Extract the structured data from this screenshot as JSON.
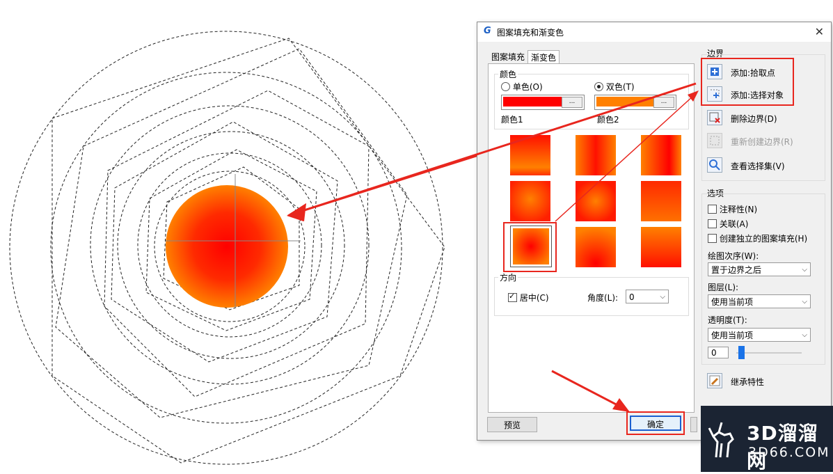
{
  "dialog": {
    "title": "图案填充和渐变色",
    "close_glyph": "✕",
    "logo_glyph": "G",
    "tabs": [
      "图案填充",
      "渐变色"
    ],
    "color_group": {
      "label": "颜色",
      "single_label": "单色(O)",
      "double_label": "双色(T)",
      "color1_label": "颜色1",
      "color2_label": "颜色2",
      "color1_hex": "#ff0000",
      "color2_hex": "#ff8000",
      "dots": "..."
    },
    "direction_group": {
      "label": "方向",
      "center_label": "居中(C)",
      "angle_label": "角度(L):",
      "angle_value": "0"
    },
    "boundary": {
      "label": "边界",
      "add_pick": "添加:拾取点",
      "add_select": "添加:选择对象",
      "remove": "删除边界(D)",
      "recreate": "重新创建边界(R)",
      "view_set": "查看选择集(V)"
    },
    "options": {
      "label": "选项",
      "annotative": "注释性(N)",
      "associative": "关联(A)",
      "separate": "创建独立的图案填充(H)",
      "draw_order_label": "绘图次序(W):",
      "draw_order_value": "置于边界之后",
      "layer_label": "图层(L):",
      "layer_value": "使用当前项",
      "transparency_label": "透明度(T):",
      "transparency_value": "使用当前项",
      "transparency_number": "0"
    },
    "inherit": "继承特性",
    "preview_button": "预览",
    "ok_button": "确定"
  },
  "watermark": {
    "brand": "3D溜溜网",
    "url": "3D66.COM"
  },
  "colors": {
    "accent_red": "#e8261e",
    "gradient_inner": "#ff0000",
    "gradient_outer": "#ff8000"
  }
}
